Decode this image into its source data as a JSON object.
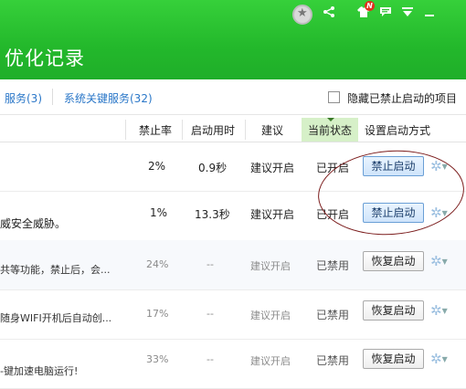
{
  "header": {
    "title": "优化记录"
  },
  "tabs": [
    {
      "label": "服务(3)"
    },
    {
      "label": "系统关键服务(32)"
    }
  ],
  "options": {
    "hide_disabled_label": "隐藏已禁止启动的项目",
    "hide_disabled_checked": false
  },
  "columns": {
    "ban_rate": "禁止率",
    "boot_time": "启动用时",
    "suggestion": "建议",
    "current_state": "当前状态",
    "set_startup": "设置启动方式"
  },
  "rows": [
    {
      "desc": "",
      "ban_rate": "2%",
      "boot_time": "0.9秒",
      "suggestion": "建议开启",
      "state": "已开启",
      "action": "禁止启动"
    },
    {
      "desc": "威安全威胁。",
      "ban_rate": "1%",
      "boot_time": "13.3秒",
      "suggestion": "建议开启",
      "state": "已开启",
      "action": "禁止启动"
    },
    {
      "desc": "共等功能，禁止后，会...",
      "ban_rate": "24%",
      "boot_time": "--",
      "suggestion": "建议开启",
      "state": "已禁用",
      "action": "恢复启动"
    },
    {
      "desc": "随身WIFI开机后自动创...",
      "ban_rate": "17%",
      "boot_time": "--",
      "suggestion": "建议开启",
      "state": "已禁用",
      "action": "恢复启动"
    },
    {
      "desc": "-键加速电脑运行!",
      "ban_rate": "33%",
      "boot_time": "--",
      "suggestion": "建议开启",
      "state": "已禁用",
      "action": "恢复启动"
    }
  ],
  "window_controls": {
    "notification_badge": "N"
  },
  "icons": [
    "avatar-star-icon",
    "share-icon",
    "skin-shirt-icon",
    "message-icon",
    "menu-icon",
    "minimize-icon",
    "gear-icon",
    "checkbox-icon"
  ],
  "colors": {
    "header_green": "#23b82b",
    "tab_blue": "#2a77c8",
    "current_state_bg": "#d6f0c8",
    "annotation_ring": "#7b1c1c"
  }
}
